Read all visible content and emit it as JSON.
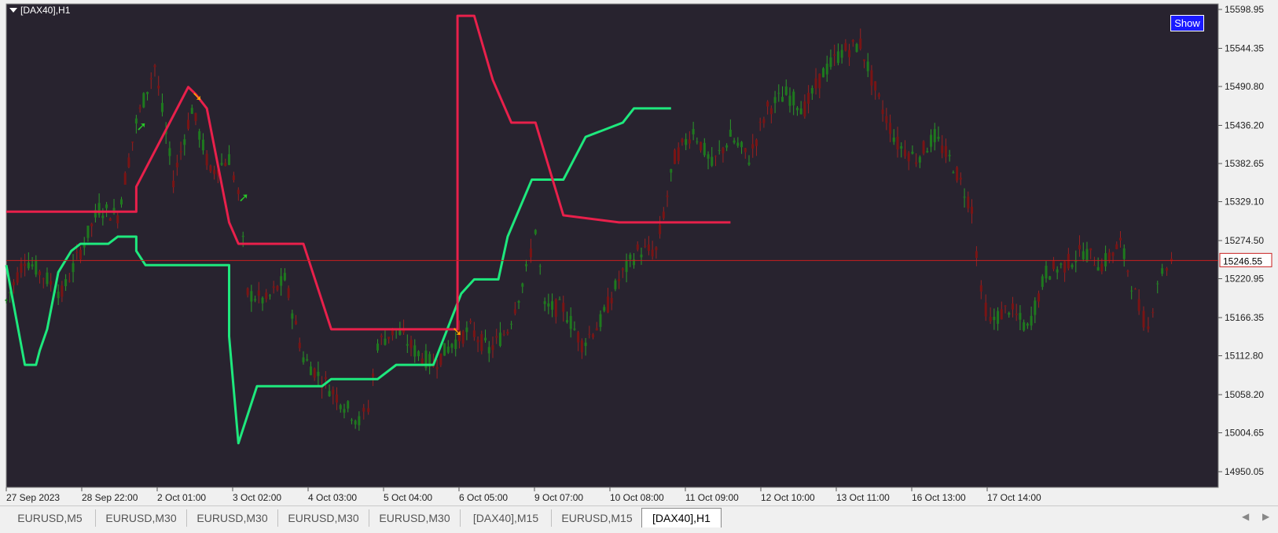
{
  "chart_data": {
    "type": "candlestick",
    "symbol_label": "[DAX40],H1",
    "current_price": "15246.55",
    "price_ticks": [
      "15598.95",
      "15544.35",
      "15490.80",
      "15436.20",
      "15382.65",
      "15329.10",
      "15274.50",
      "15220.95",
      "15166.35",
      "15112.80",
      "15058.20",
      "15004.65",
      "14950.05"
    ],
    "ylim": [
      14950.05,
      15598.95
    ],
    "time_ticks": [
      "27 Sep 2023",
      "28 Sep 22:00",
      "2 Oct 01:00",
      "3 Oct 02:00",
      "4 Oct 03:00",
      "5 Oct 04:00",
      "6 Oct 05:00",
      "9 Oct 07:00",
      "10 Oct 08:00",
      "11 Oct 09:00",
      "12 Oct 10:00",
      "13 Oct 11:00",
      "16 Oct 13:00",
      "17 Oct 14:00"
    ],
    "price_path": [
      [
        0,
        15190
      ],
      [
        10,
        15250
      ],
      [
        20,
        15225
      ],
      [
        30,
        15200
      ],
      [
        40,
        15260
      ],
      [
        50,
        15320
      ],
      [
        60,
        15310
      ],
      [
        70,
        15440
      ],
      [
        80,
        15520
      ],
      [
        90,
        15360
      ],
      [
        100,
        15460
      ],
      [
        110,
        15370
      ],
      [
        120,
        15390
      ],
      [
        125,
        15340
      ],
      [
        130,
        15200
      ],
      [
        140,
        15190
      ],
      [
        150,
        15220
      ],
      [
        160,
        15110
      ],
      [
        170,
        15080
      ],
      [
        180,
        15050
      ],
      [
        190,
        15020
      ],
      [
        195,
        15040
      ],
      [
        200,
        15130
      ],
      [
        210,
        15150
      ],
      [
        220,
        15120
      ],
      [
        230,
        15100
      ],
      [
        240,
        15130
      ],
      [
        250,
        15150
      ],
      [
        260,
        15120
      ],
      [
        270,
        15150
      ],
      [
        280,
        15230
      ],
      [
        285,
        15290
      ],
      [
        290,
        15180
      ],
      [
        300,
        15180
      ],
      [
        310,
        15130
      ],
      [
        320,
        15160
      ],
      [
        330,
        15220
      ],
      [
        340,
        15260
      ],
      [
        350,
        15260
      ],
      [
        360,
        15390
      ],
      [
        370,
        15430
      ],
      [
        380,
        15380
      ],
      [
        390,
        15420
      ],
      [
        400,
        15390
      ],
      [
        410,
        15460
      ],
      [
        420,
        15480
      ],
      [
        430,
        15460
      ],
      [
        440,
        15510
      ],
      [
        450,
        15540
      ],
      [
        460,
        15550
      ],
      [
        470,
        15470
      ],
      [
        480,
        15410
      ],
      [
        490,
        15390
      ],
      [
        500,
        15420
      ],
      [
        510,
        15380
      ],
      [
        520,
        15320
      ],
      [
        525,
        15200
      ],
      [
        530,
        15160
      ],
      [
        540,
        15180
      ],
      [
        550,
        15150
      ],
      [
        560,
        15230
      ],
      [
        570,
        15240
      ],
      [
        580,
        15260
      ],
      [
        590,
        15240
      ],
      [
        600,
        15270
      ],
      [
        610,
        15180
      ],
      [
        615,
        15150
      ],
      [
        620,
        15220
      ],
      [
        625,
        15240
      ],
      [
        630,
        15250
      ]
    ],
    "support_line": [
      [
        0,
        15240
      ],
      [
        10,
        15100
      ],
      [
        16,
        15100
      ],
      [
        18,
        15120
      ],
      [
        22,
        15150
      ],
      [
        28,
        15230
      ],
      [
        35,
        15260
      ],
      [
        40,
        15270
      ],
      [
        55,
        15270
      ],
      [
        60,
        15280
      ],
      [
        70,
        15280
      ],
      [
        70,
        15260
      ],
      [
        75,
        15240
      ],
      [
        100,
        15240
      ],
      [
        120,
        15240
      ],
      [
        120,
        15140
      ],
      [
        125,
        14990
      ],
      [
        135,
        15070
      ],
      [
        150,
        15070
      ],
      [
        170,
        15070
      ],
      [
        175,
        15080
      ],
      [
        200,
        15080
      ],
      [
        210,
        15100
      ],
      [
        230,
        15100
      ],
      [
        245,
        15200
      ],
      [
        252,
        15220
      ],
      [
        265,
        15220
      ],
      [
        270,
        15280
      ],
      [
        283,
        15360
      ],
      [
        295,
        15360
      ],
      [
        300,
        15360
      ],
      [
        312,
        15420
      ],
      [
        332,
        15440
      ],
      [
        338,
        15460
      ],
      [
        358,
        15460
      ]
    ],
    "resistance_line": [
      [
        0,
        15315
      ],
      [
        70,
        15315
      ],
      [
        70,
        15350
      ],
      [
        98,
        15490
      ],
      [
        102,
        15480
      ],
      [
        108,
        15460
      ],
      [
        120,
        15300
      ],
      [
        125,
        15270
      ],
      [
        160,
        15270
      ],
      [
        175,
        15150
      ],
      [
        200,
        15150
      ],
      [
        243,
        15150
      ],
      [
        243,
        15590
      ],
      [
        252,
        15590
      ],
      [
        262,
        15500
      ],
      [
        272,
        15440
      ],
      [
        285,
        15440
      ],
      [
        300,
        15310
      ],
      [
        330,
        15300
      ],
      [
        390,
        15300
      ]
    ],
    "signals": [
      {
        "type": "buy",
        "x": 70
      },
      {
        "type": "sell",
        "x": 100
      },
      {
        "type": "buy",
        "x": 125
      },
      {
        "type": "sell",
        "x": 240
      }
    ]
  },
  "ui": {
    "show_button": "Show",
    "tabs": [
      "EURUSD,M5",
      "EURUSD,M30",
      "EURUSD,M30",
      "EURUSD,M30",
      "EURUSD,M30",
      "[DAX40],M15",
      "EURUSD,M15",
      "[DAX40],H1"
    ],
    "active_tab_index": 7
  },
  "colors": {
    "background": "#28232f",
    "up_candle": "#1e7a1e",
    "down_candle": "#7a1414",
    "support": "#1ee87d",
    "resistance": "#e8204b",
    "price_line": "#c81e1e",
    "axis_text": "#e0e0e0",
    "buy_arrow": "#28c828",
    "sell_arrow": "#ffa500"
  }
}
